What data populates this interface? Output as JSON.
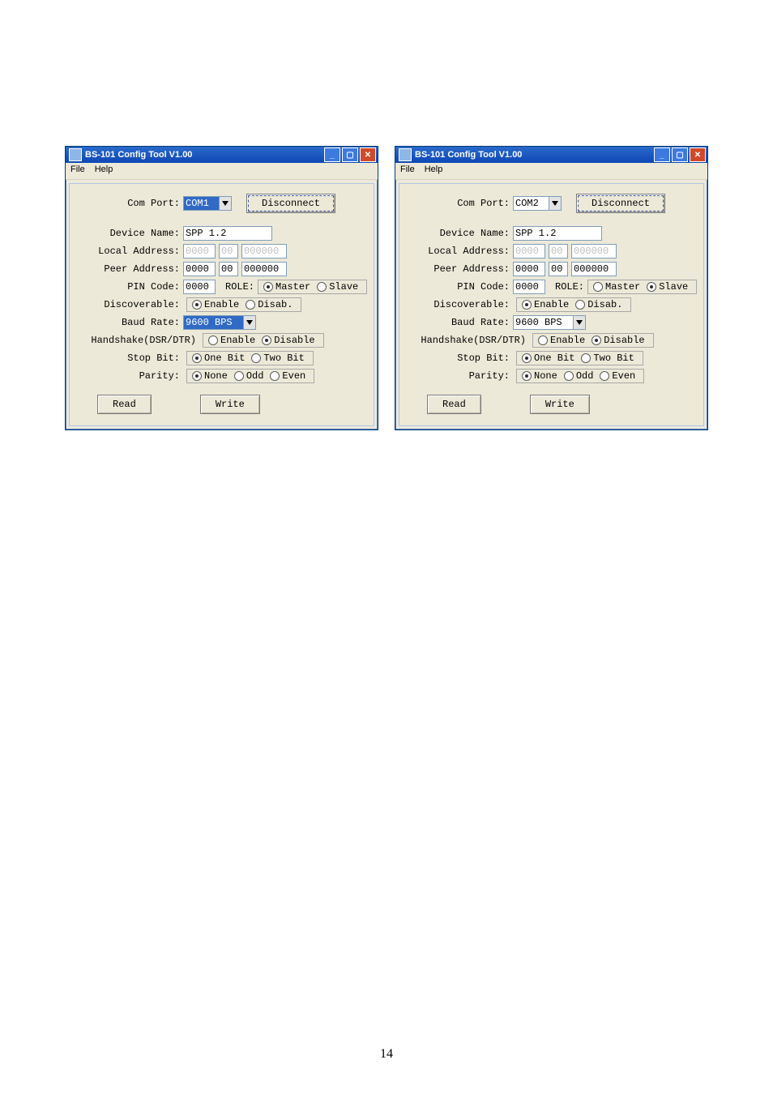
{
  "page_number": "14",
  "windows": [
    {
      "title": "BS-101 Config Tool V1.00",
      "com_port_value": "COM1",
      "com_port_highlight": true,
      "role": {
        "master": true,
        "slave": false
      },
      "baud_highlight": true
    },
    {
      "title": "BS-101 Config Tool V1.00",
      "com_port_value": "COM2",
      "com_port_highlight": false,
      "role": {
        "master": false,
        "slave": true
      },
      "baud_highlight": false
    }
  ],
  "shared": {
    "menu": {
      "file": "File",
      "help": "Help"
    },
    "labels": {
      "com_port": "Com Port:",
      "device_name": "Device Name:",
      "local_address": "Local Address:",
      "peer_address": "Peer Address:",
      "pin_code": "PIN Code:",
      "role": "ROLE:",
      "discoverable": "Discoverable:",
      "baud_rate": "Baud Rate:",
      "handshake": "Handshake(DSR/DTR)",
      "stop_bit": "Stop Bit:",
      "parity": "Parity:"
    },
    "buttons": {
      "disconnect": "Disconnect",
      "read": "Read",
      "write": "Write"
    },
    "values": {
      "device_name": "SPP 1.2",
      "addr1": "0000",
      "addr2": "00",
      "addr3": "000000",
      "pin": "0000",
      "baud": "9600 BPS"
    },
    "radio_labels": {
      "master": "Master",
      "slave": "Slave",
      "enable": "Enable",
      "disable": "Disable",
      "disab_short": "Disab.",
      "one_bit": "One Bit",
      "two_bit": "Two Bit",
      "none": "None",
      "odd": "Odd",
      "even": "Even"
    }
  }
}
